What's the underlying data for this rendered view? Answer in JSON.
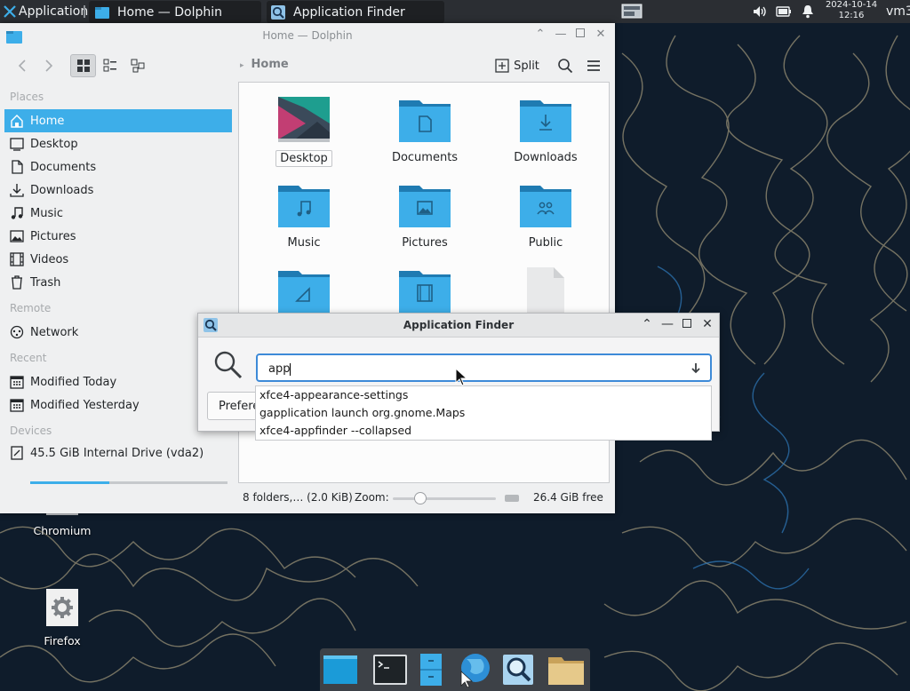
{
  "top_panel": {
    "applications_label": "Applications",
    "tasks": [
      {
        "label": "Home — Dolphin"
      },
      {
        "label": "Application Finder"
      }
    ],
    "clock_date": "2024-10-14",
    "clock_time": "12:16",
    "user_label": "vm3"
  },
  "dolphin": {
    "title": "Home — Dolphin",
    "breadcrumb": "Home",
    "split_label": "Split",
    "places": {
      "sections": {
        "places": "Places",
        "remote": "Remote",
        "recent": "Recent",
        "devices": "Devices"
      },
      "items": {
        "home": "Home",
        "desktop": "Desktop",
        "documents": "Documents",
        "downloads": "Downloads",
        "music": "Music",
        "pictures": "Pictures",
        "videos": "Videos",
        "trash": "Trash",
        "network": "Network",
        "modified_today": "Modified Today",
        "modified_yesterday": "Modified Yesterday",
        "drive": "45.5 GiB Internal Drive (vda2)"
      },
      "drive_usage_fraction": 0.4
    },
    "files": [
      {
        "label": "Desktop"
      },
      {
        "label": "Documents"
      },
      {
        "label": "Downloads"
      },
      {
        "label": "Music"
      },
      {
        "label": "Pictures"
      },
      {
        "label": "Public"
      }
    ],
    "status": {
      "summary": "8 folders,… (2.0 KiB)",
      "zoom_label": "Zoom:",
      "free_space": "26.4 GiB free"
    }
  },
  "app_finder": {
    "title": "Application Finder",
    "query": "app",
    "preferences_label": "Preferences",
    "suggestions": [
      "xfce4-appearance-settings",
      "gapplication launch org.gnome.Maps",
      "xfce4-appfinder --collapsed"
    ]
  },
  "desktop_icons": {
    "chromium": "Chromium",
    "firefox": "Firefox"
  },
  "colors": {
    "accent": "#3daee9",
    "folder": "#3daee9",
    "panel": "#2b2e33"
  }
}
